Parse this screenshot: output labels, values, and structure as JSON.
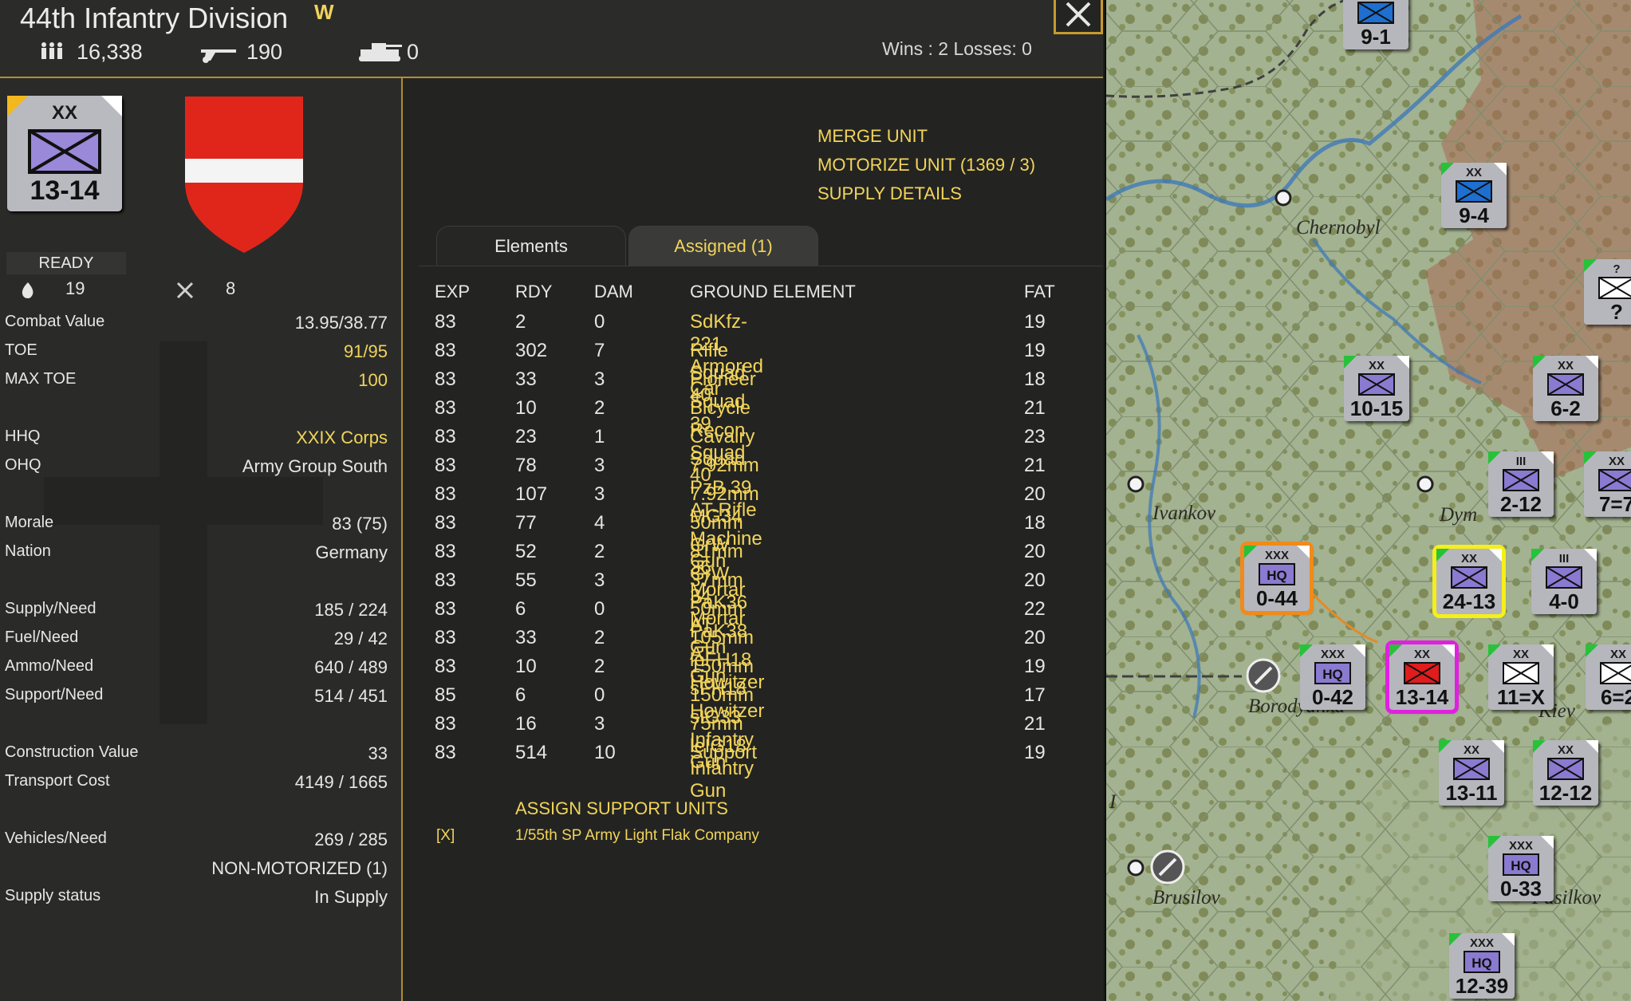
{
  "unit": {
    "title": "44th Infantry Division",
    "flag": "W",
    "men": "16,338",
    "guns": "190",
    "tanks": "0",
    "record": "Wins : 2  Losses: 0",
    "counter_size": "XX",
    "counter_strength": "13-14",
    "status": "READY",
    "moves": "19",
    "attacks": "8"
  },
  "stats": [
    {
      "label": "Combat Value",
      "value": "13.95/38.77"
    },
    {
      "label": "TOE",
      "value": "91/95"
    },
    {
      "label": "MAX TOE",
      "value": "100"
    },
    {
      "label": "HHQ",
      "value": "XXIX Corps"
    },
    {
      "label": "OHQ",
      "value": "Army Group South"
    },
    {
      "label": "Morale",
      "value": "83 (75)"
    },
    {
      "label": "Nation",
      "value": "Germany"
    },
    {
      "label": "Supply/Need",
      "value": "185 / 224"
    },
    {
      "label": "Fuel/Need",
      "value": "29 / 42"
    },
    {
      "label": "Ammo/Need",
      "value": "640 / 489"
    },
    {
      "label": "Support/Need",
      "value": "514 / 451"
    },
    {
      "label": "Construction Value",
      "value": "33"
    },
    {
      "label": "Transport Cost",
      "value": "4149 / 1665"
    },
    {
      "label": "Vehicles/Need",
      "value": "269 / 285"
    },
    {
      "label": "",
      "value": "NON-MOTORIZED (1)"
    },
    {
      "label": "Supply status",
      "value": "In Supply"
    }
  ],
  "actions": [
    "MERGE UNIT",
    "MOTORIZE UNIT (1369 / 3)",
    "SUPPLY DETAILS"
  ],
  "tabs": {
    "elements": "Elements",
    "assigned": "Assigned (1)"
  },
  "table": {
    "headers": [
      "EXP",
      "RDY",
      "DAM",
      "GROUND ELEMENT",
      "FAT"
    ],
    "rows": [
      [
        "83",
        "2",
        "0",
        "SdKfz-221 Armored Car",
        "19"
      ],
      [
        "83",
        "302",
        "7",
        "Rifle Squad 40",
        "19"
      ],
      [
        "83",
        "33",
        "3",
        "Pioneer Squad 39",
        "18"
      ],
      [
        "83",
        "10",
        "2",
        "Bicycle Recon Squad 40",
        "21"
      ],
      [
        "83",
        "23",
        "1",
        "Cavalry Squad",
        "23"
      ],
      [
        "83",
        "78",
        "3",
        "7.92mm PzB 39 AT-Rifle",
        "21"
      ],
      [
        "83",
        "107",
        "3",
        "7.92mm MG34 Machine Gun",
        "20"
      ],
      [
        "83",
        "77",
        "4",
        "50mm GrW 36 Mortar",
        "18"
      ],
      [
        "83",
        "52",
        "2",
        "81mm GrW 34 Mortar",
        "20"
      ],
      [
        "83",
        "55",
        "3",
        "37mm PaK36 AT Gun",
        "20"
      ],
      [
        "83",
        "6",
        "0",
        "50mm PaK38 AT Gun",
        "22"
      ],
      [
        "83",
        "33",
        "2",
        "105mm leFH18 Howitzer",
        "20"
      ],
      [
        "83",
        "10",
        "2",
        "150mm sFH18 Howitzer",
        "19"
      ],
      [
        "85",
        "6",
        "0",
        "150mm sIG33 Infantry Gun",
        "17"
      ],
      [
        "83",
        "16",
        "3",
        "75mm leIG18 Infantry Gun",
        "21"
      ],
      [
        "83",
        "514",
        "10",
        "Support",
        "19"
      ]
    ]
  },
  "support": {
    "title": "ASSIGN SUPPORT UNITS",
    "marker": "[X]",
    "unit": "1/55th SP Army Light Flak Company"
  },
  "map": {
    "towns": [
      "Chernobyl",
      "Ivankov",
      "Dym",
      "Borodyanka",
      "Kiev",
      "Brusilov",
      "Fasilkov",
      "I"
    ],
    "counters": [
      {
        "size": "XX",
        "strength": "9-1",
        "color": "#1e6fd0"
      },
      {
        "size": "XX",
        "strength": "9-4",
        "color": "#1e6fd0"
      },
      {
        "size": "XX",
        "strength": "10-15",
        "color": "#8a7ad0"
      },
      {
        "size": "XX",
        "strength": "6-2",
        "color": "#8a7ad0"
      },
      {
        "size": "III",
        "strength": "2-12",
        "color": "#8a7ad0"
      },
      {
        "size": "XX",
        "strength": "7=7",
        "color": "#8a7ad0"
      },
      {
        "size": "?",
        "strength": "?",
        "color": "#ffffff"
      },
      {
        "size": "XXX",
        "strength": "0-44",
        "color": "#8a7ad0"
      },
      {
        "size": "XX",
        "strength": "24-13",
        "color": "#8a7ad0"
      },
      {
        "size": "III",
        "strength": "4-0",
        "color": "#8a7ad0"
      },
      {
        "size": "XXX",
        "strength": "0-42",
        "color": "#8a7ad0"
      },
      {
        "size": "XX",
        "strength": "13-14",
        "color": "#e01c1c"
      },
      {
        "size": "XX",
        "strength": "11=X",
        "color": "#ffffff"
      },
      {
        "size": "XX",
        "strength": "6=2",
        "color": "#ffffff"
      },
      {
        "size": "XX",
        "strength": "13-11",
        "color": "#8a7ad0"
      },
      {
        "size": "XX",
        "strength": "12-12",
        "color": "#8a7ad0"
      },
      {
        "size": "XXX",
        "strength": "0-33",
        "color": "#8a7ad0"
      },
      {
        "size": "XXX",
        "strength": "12-39",
        "color": "#8a7ad0"
      }
    ],
    "hq_label": "HQ"
  },
  "colors": {
    "accent": "#f2d45a",
    "border": "#b58c2e",
    "panel": "#2a2b29"
  }
}
